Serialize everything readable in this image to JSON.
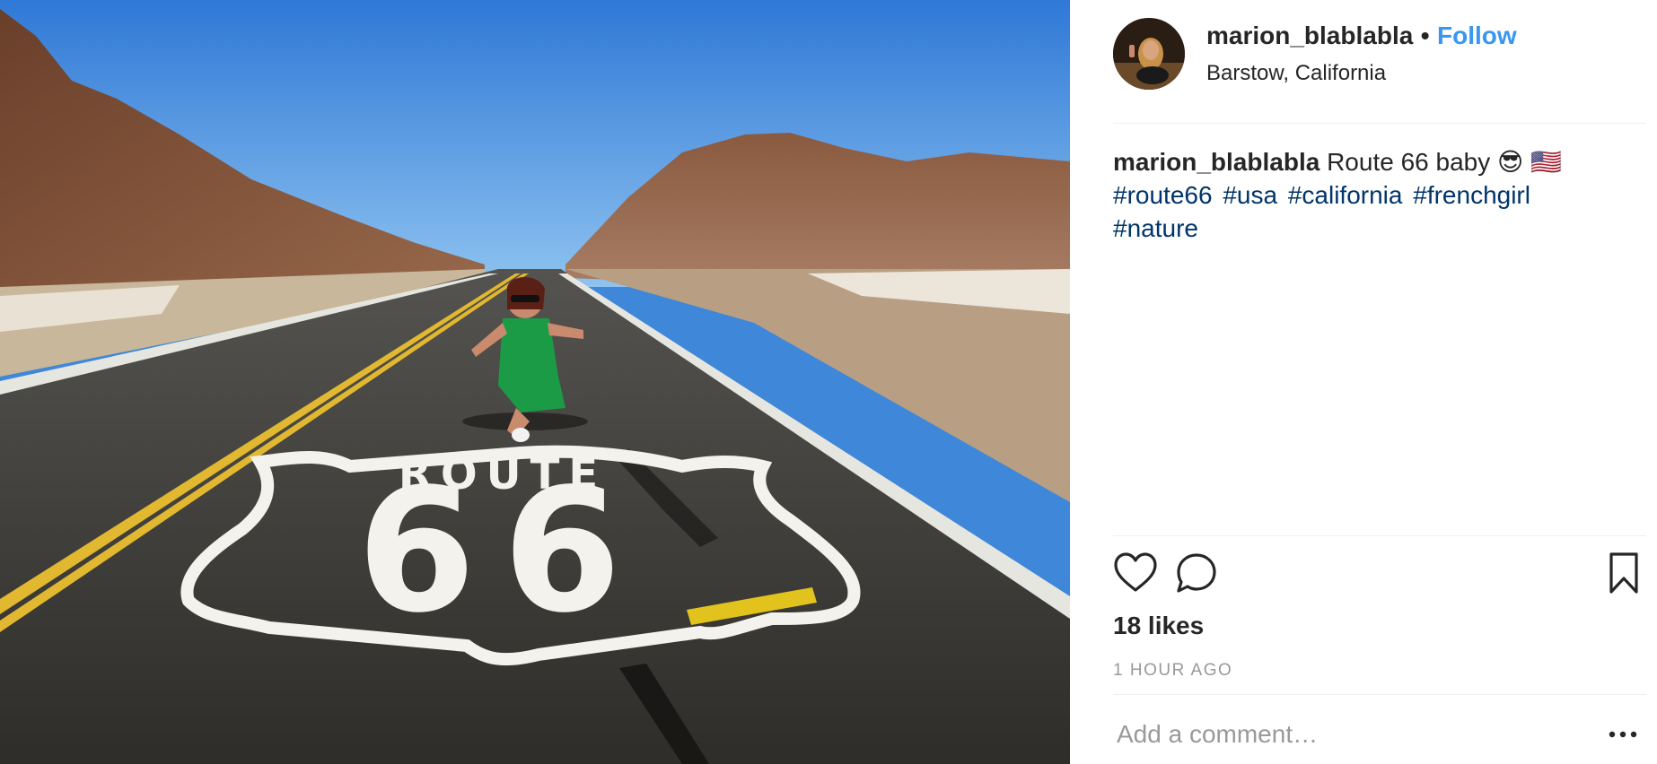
{
  "post": {
    "username": "marion_blablabla",
    "separator": "•",
    "follow_label": "Follow",
    "location": "Barstow, California",
    "caption_text": "Route 66 baby 😎 🇺🇸",
    "hashtags": [
      "#route66",
      "#usa",
      "#california",
      "#frenchgirl",
      "#nature"
    ],
    "likes": "18 likes",
    "time": "1 HOUR AGO"
  },
  "comment": {
    "placeholder": "Add a comment…"
  },
  "photo": {
    "shield_word": "ROUTE",
    "shield_number": "66"
  },
  "icons": {
    "like": "heart-outline-icon",
    "comment": "speech-bubble-icon",
    "save": "bookmark-icon",
    "more": "more-dots-icon"
  },
  "colors": {
    "follow": "#3897f0",
    "hashtag": "#003569",
    "muted": "#999999"
  }
}
